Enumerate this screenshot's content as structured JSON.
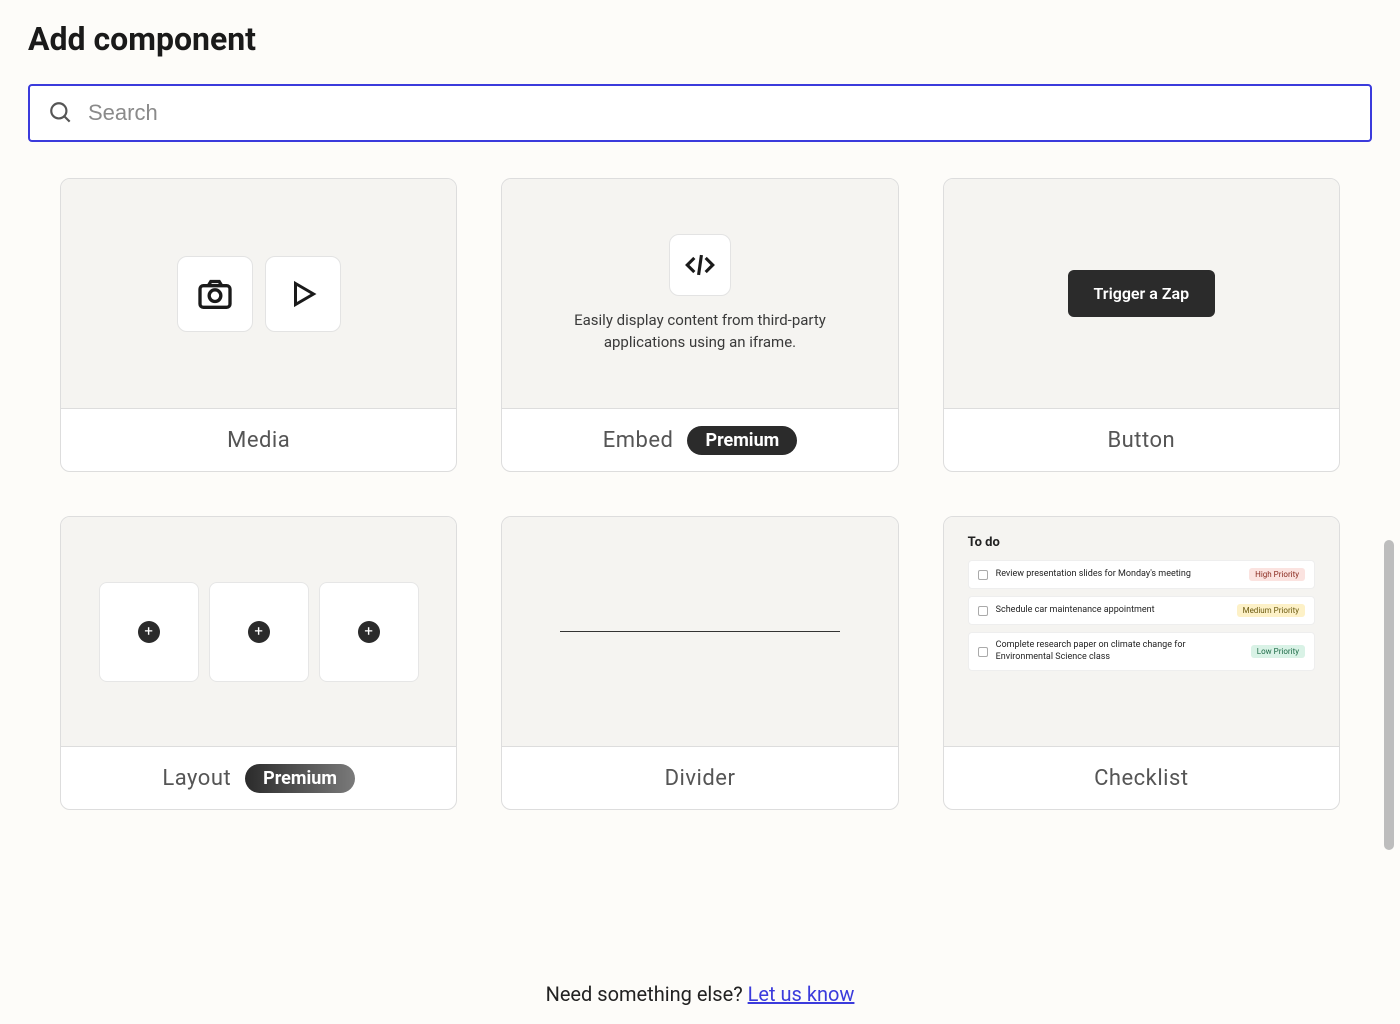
{
  "page_title": "Add component",
  "search": {
    "placeholder": "Search"
  },
  "components": {
    "media": {
      "label": "Media"
    },
    "embed": {
      "label": "Embed",
      "badge": "Premium",
      "preview_text": "Easily display content from third-party applications using an iframe."
    },
    "button": {
      "label": "Button",
      "preview_button": "Trigger a Zap"
    },
    "layout": {
      "label": "Layout",
      "badge": "Premium"
    },
    "divider": {
      "label": "Divider"
    },
    "checklist": {
      "label": "Checklist",
      "preview": {
        "title": "To do",
        "items": [
          {
            "text": "Review presentation slides for Monday's meeting",
            "priority_label": "High Priority",
            "priority": "high"
          },
          {
            "text": "Schedule car maintenance appointment",
            "priority_label": "Medium Priority",
            "priority": "med"
          },
          {
            "text": "Complete research paper on climate change for Environmental Science class",
            "priority_label": "Low Priority",
            "priority": "low"
          }
        ]
      }
    }
  },
  "footer": {
    "prompt": "Need something else? ",
    "link_text": "Let us know"
  }
}
